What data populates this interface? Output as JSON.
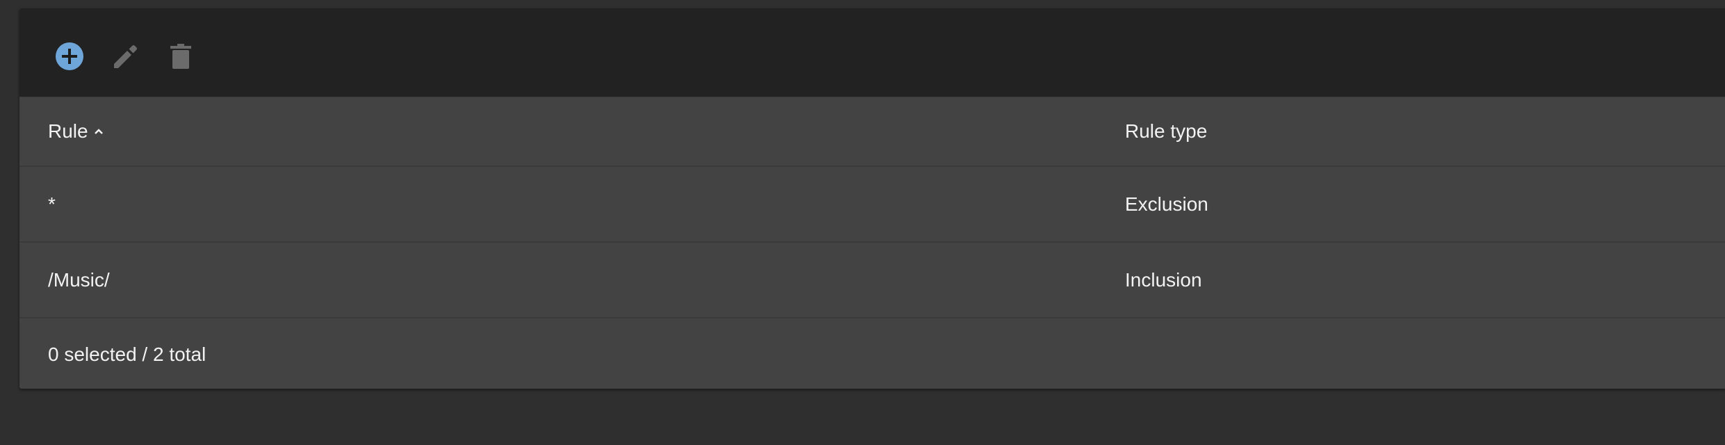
{
  "toolbar": {
    "add_icon": "plus-circle-icon",
    "edit_icon": "pencil-icon",
    "delete_icon": "trash-icon",
    "accent_color": "#6ea6d9",
    "disabled_color": "#6b6b6b"
  },
  "table": {
    "columns": [
      {
        "label": "Rule",
        "sorted": "ascending"
      },
      {
        "label": "Rule type"
      }
    ],
    "rows": [
      {
        "rule": "*",
        "rule_type": "Exclusion"
      },
      {
        "rule": "/Music/",
        "rule_type": "Inclusion"
      }
    ],
    "footer": "0 selected / 2 total"
  }
}
